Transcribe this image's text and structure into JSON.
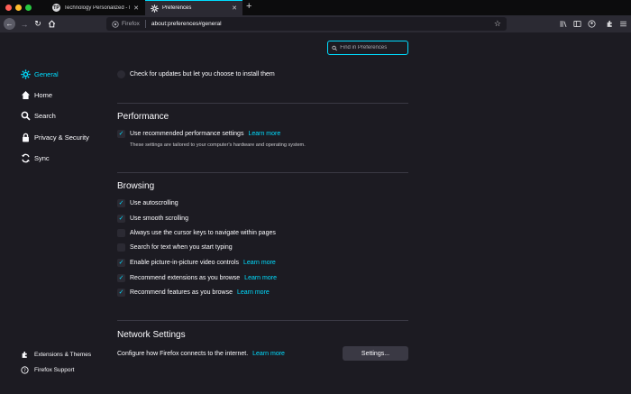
{
  "browser": {
    "tabs": [
      {
        "title": "Technology Personalized - How",
        "favicon": "tp-favicon-icon",
        "active": false
      },
      {
        "title": "Preferences",
        "favicon": "gear-icon",
        "active": true
      }
    ],
    "new_tab_label": "+",
    "url_identity": "Firefox",
    "url": "about:preferences#general",
    "colors": {
      "accent": "#00ddff",
      "background": "#1c1b22",
      "toolbar": "#2b2a33"
    }
  },
  "search": {
    "placeholder": "Find in Preferences",
    "value": ""
  },
  "sidebar": {
    "items": [
      {
        "label": "General",
        "icon": "gear-icon",
        "selected": true
      },
      {
        "label": "Home",
        "icon": "home-icon",
        "selected": false
      },
      {
        "label": "Search",
        "icon": "search-icon",
        "selected": false
      },
      {
        "label": "Privacy & Security",
        "icon": "lock-icon",
        "selected": false
      },
      {
        "label": "Sync",
        "icon": "sync-icon",
        "selected": false
      }
    ],
    "footer": [
      {
        "label": "Extensions & Themes",
        "icon": "puzzle-icon"
      },
      {
        "label": "Firefox Support",
        "icon": "help-icon"
      }
    ]
  },
  "updates": {
    "option_label": "Check for updates but let you choose to install them"
  },
  "performance": {
    "title": "Performance",
    "recommended_label": "Use recommended performance settings",
    "recommended_checked": true,
    "learn_more": "Learn more",
    "description": "These settings are tailored to your computer's hardware and operating system."
  },
  "browsing": {
    "title": "Browsing",
    "options": [
      {
        "label": "Use autoscrolling",
        "checked": true,
        "link": ""
      },
      {
        "label": "Use smooth scrolling",
        "checked": true,
        "link": ""
      },
      {
        "label": "Always use the cursor keys to navigate within pages",
        "checked": false,
        "link": ""
      },
      {
        "label": "Search for text when you start typing",
        "checked": false,
        "link": ""
      },
      {
        "label": "Enable picture-in-picture video controls",
        "checked": true,
        "link": "Learn more"
      },
      {
        "label": "Recommend extensions as you browse",
        "checked": true,
        "link": "Learn more"
      },
      {
        "label": "Recommend features as you browse",
        "checked": true,
        "link": "Learn more"
      }
    ]
  },
  "network": {
    "title": "Network Settings",
    "description": "Configure how Firefox connects to the internet.",
    "learn_more": "Learn more",
    "button_label": "Settings..."
  }
}
